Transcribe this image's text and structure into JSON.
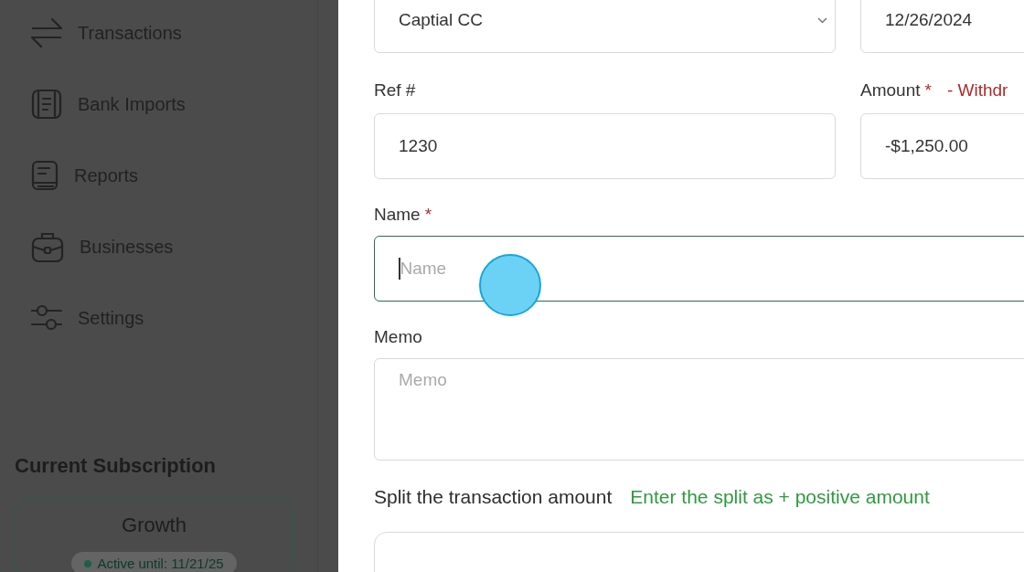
{
  "sidebar": {
    "items": [
      {
        "label": "Transactions",
        "kind": "transfer"
      },
      {
        "label": "Bank Imports",
        "kind": "document"
      },
      {
        "label": "Reports",
        "kind": "book"
      },
      {
        "label": "Businesses",
        "kind": "briefcase"
      },
      {
        "label": "Settings",
        "kind": "sliders"
      }
    ],
    "subscription": {
      "title": "Current Subscription",
      "plan": "Growth",
      "status": "Active until: 11/21/25"
    }
  },
  "form": {
    "account": {
      "value": "Captial CC"
    },
    "date": {
      "value": "12/26/2024"
    },
    "ref": {
      "label": "Ref #",
      "value": "1230"
    },
    "amount": {
      "label": "Amount",
      "required_mark": "*",
      "note": "- Withdr",
      "value": "-$1,250.00"
    },
    "name": {
      "label": "Name",
      "required_mark": "*",
      "placeholder": "Name",
      "focused": true
    },
    "memo": {
      "label": "Memo",
      "placeholder": "Memo"
    },
    "split": {
      "label": "Split the transaction amount",
      "hint": "Enter the split as + positive amount"
    }
  },
  "click_marker": {
    "shown": true
  }
}
